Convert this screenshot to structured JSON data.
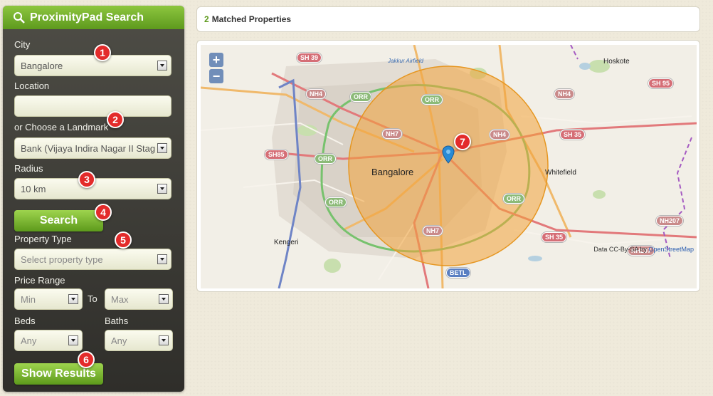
{
  "app": {
    "title": "ProximityPad Search"
  },
  "form": {
    "city_label": "City",
    "city_value": "Bangalore",
    "location_label": "Location",
    "location_value": "",
    "landmark_label": "or Choose a Landmark",
    "landmark_value": "Bank (Vijaya Indira Nagar II Stag",
    "radius_label": "Radius",
    "radius_value": "10 km",
    "search_button": "Search",
    "property_type_label": "Property Type",
    "property_type_placeholder": "Select property type",
    "price_range_label": "Price Range",
    "price_min": "Min",
    "price_to": "To",
    "price_max": "Max",
    "beds_label": "Beds",
    "beds_value": "Any",
    "baths_label": "Baths",
    "baths_value": "Any",
    "show_results_button": "Show Results"
  },
  "badges": [
    "1",
    "2",
    "3",
    "4",
    "5",
    "6",
    "7"
  ],
  "results": {
    "count": "2",
    "label": "Matched Properties"
  },
  "map": {
    "zoom_in": "+",
    "zoom_out": "−",
    "attribution_prefix": "Data CC-By-SA by",
    "attribution_link": "OpenStreetMap",
    "labels": {
      "city": "Bangalore",
      "kengeri": "Kengeri",
      "whitefield": "Whitefield",
      "hoskote": "Hoskote",
      "airfield": "Jakkur Airfield"
    },
    "shields": [
      "SH 39",
      "NH4",
      "ORR",
      "SH 95",
      "NH4",
      "ORR",
      "SH 35",
      "NH7",
      "NH4",
      "SH85",
      "ORR",
      "ORR",
      "NH7",
      "ORR",
      "SH 35",
      "NH207",
      "NH207",
      "BETL"
    ],
    "colors": {
      "radius_fill": "#f3a23a",
      "marker": "#2a8ad4",
      "accent": "#6aa824"
    }
  }
}
